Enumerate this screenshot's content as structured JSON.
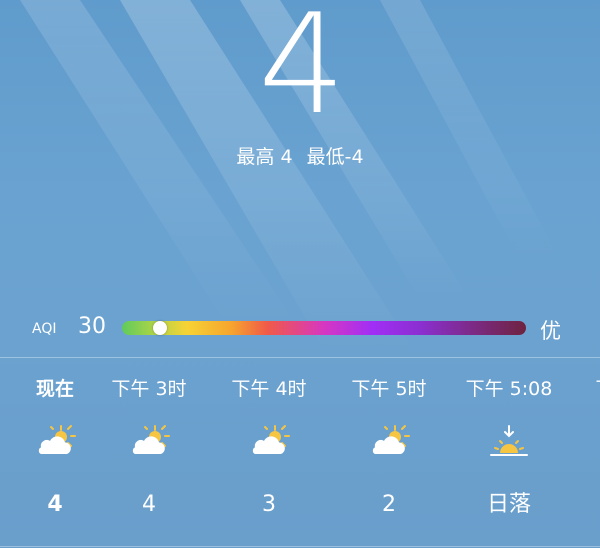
{
  "current": {
    "temperature": "4",
    "high": "最高 4",
    "low": "最低-4"
  },
  "aqi": {
    "label": "AQI",
    "value": "30",
    "status": "优",
    "level_fraction": 0.095
  },
  "hourly": [
    {
      "time": "现在",
      "icon": "partly-cloudy-day-icon",
      "temp": "4"
    },
    {
      "time": "下午 3时",
      "icon": "partly-cloudy-day-icon",
      "temp": "4"
    },
    {
      "time": "下午 4时",
      "icon": "partly-cloudy-day-icon",
      "temp": "3"
    },
    {
      "time": "下午 5时",
      "icon": "partly-cloudy-day-icon",
      "temp": "2"
    },
    {
      "time": "下午 5:08",
      "icon": "sunset-icon",
      "temp": "日落"
    },
    {
      "time": "下",
      "icon": "",
      "temp": ""
    }
  ],
  "colors": {
    "sky": "#6aa3d1",
    "sun": "#f6c542",
    "aqi_thumb": "#ffffff"
  }
}
